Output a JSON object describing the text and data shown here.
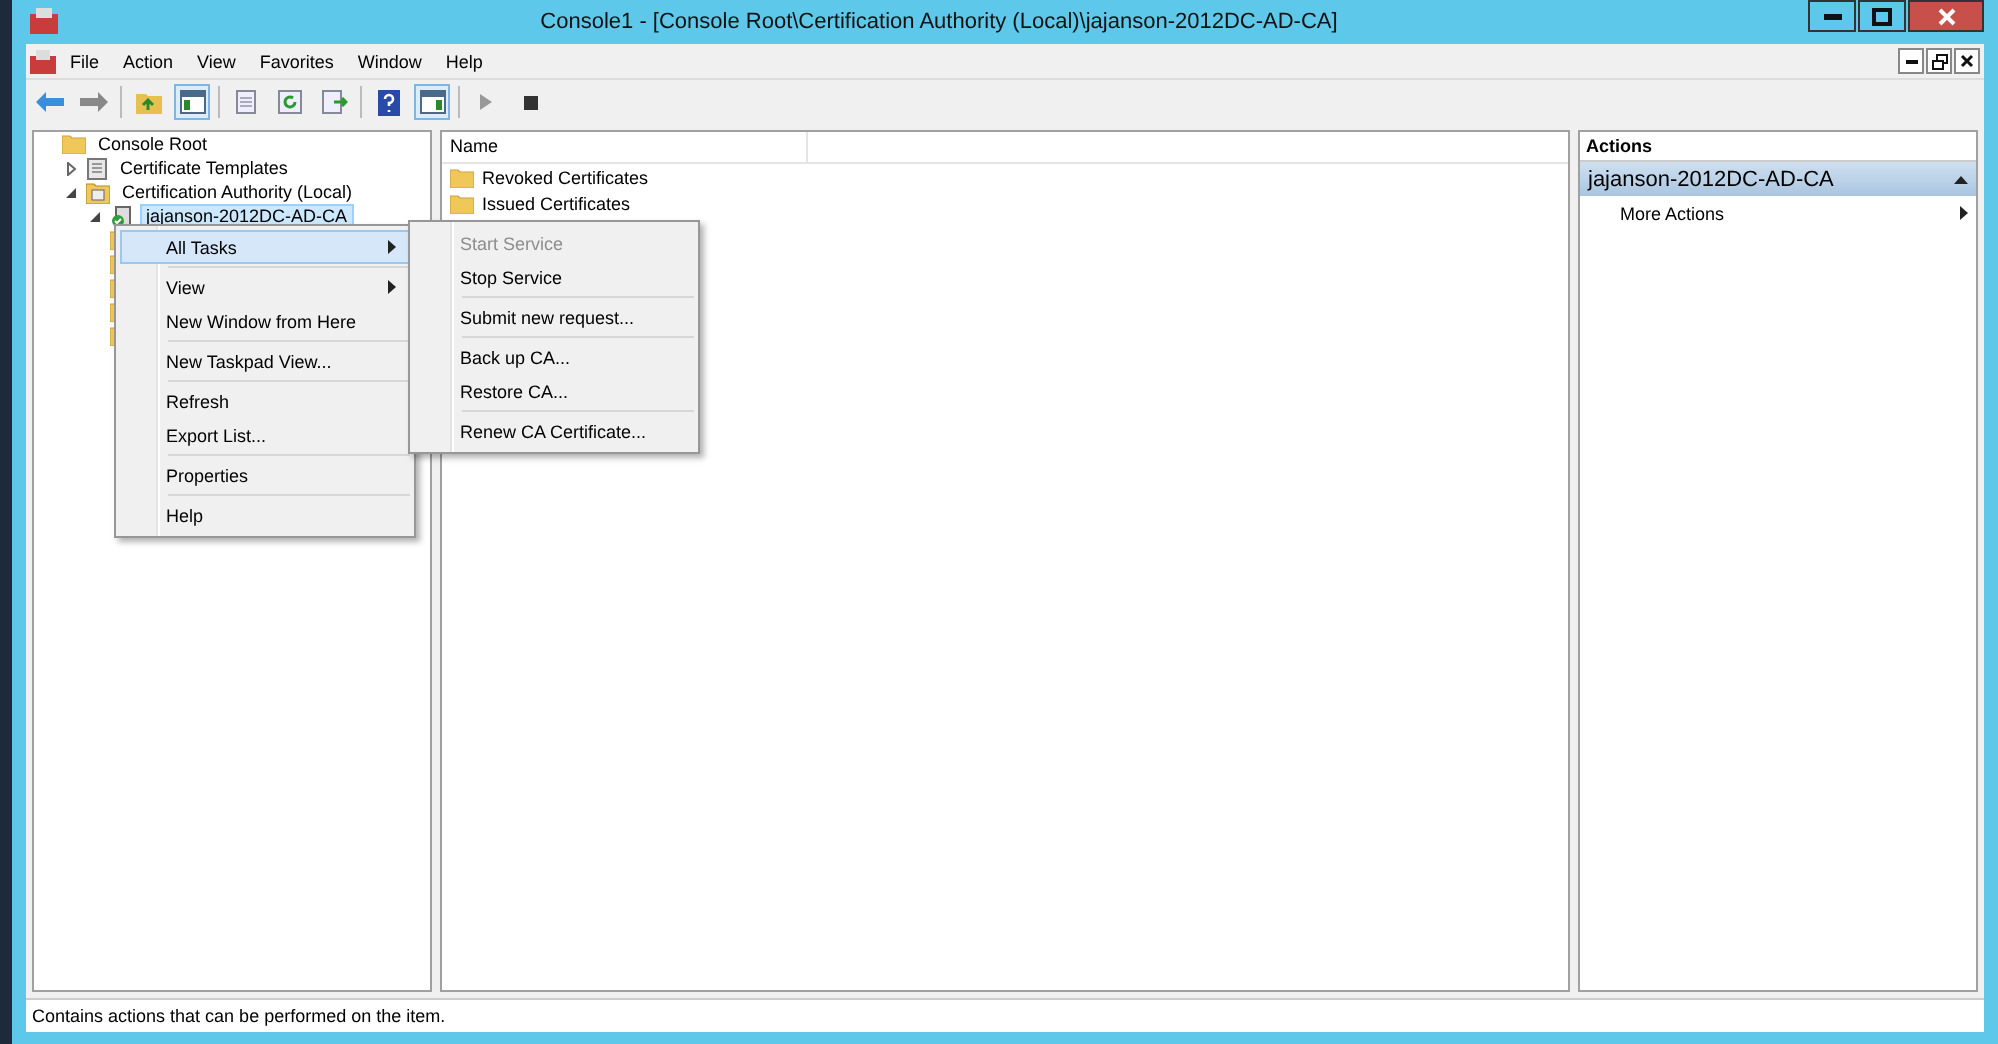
{
  "window": {
    "title": "Console1 - [Console Root\\Certification Authority (Local)\\jajanson-2012DC-AD-CA]"
  },
  "menu_bar": [
    "File",
    "Action",
    "View",
    "Favorites",
    "Window",
    "Help"
  ],
  "tree": [
    {
      "label": "Console Root",
      "children": [
        {
          "label": "Certificate Templates",
          "expanded": false
        },
        {
          "label": "Certification Authority (Local)",
          "expanded": true,
          "children": [
            {
              "label": "jajanson-2012DC-AD-CA",
              "expanded": true,
              "selected": true
            }
          ]
        }
      ]
    }
  ],
  "list": {
    "columns": [
      "Name"
    ],
    "rows": [
      "Revoked Certificates",
      "Issued Certificates"
    ]
  },
  "context_menu": [
    {
      "kind": "item",
      "label": "All Tasks",
      "submenu": true,
      "selected": true
    },
    {
      "kind": "separator"
    },
    {
      "kind": "item",
      "label": "View",
      "submenu": true,
      "selected": false
    },
    {
      "kind": "item",
      "label": "New Window from Here",
      "submenu": false,
      "selected": false
    },
    {
      "kind": "separator"
    },
    {
      "kind": "item",
      "label": "New Taskpad View...",
      "submenu": false,
      "selected": false
    },
    {
      "kind": "separator"
    },
    {
      "kind": "item",
      "label": "Refresh",
      "submenu": false,
      "selected": false
    },
    {
      "kind": "item",
      "label": "Export List...",
      "submenu": false,
      "selected": false
    },
    {
      "kind": "separator"
    },
    {
      "kind": "item",
      "label": "Properties",
      "submenu": false,
      "selected": false
    },
    {
      "kind": "separator"
    },
    {
      "kind": "item",
      "label": "Help",
      "submenu": false,
      "selected": false
    }
  ],
  "submenu": [
    {
      "kind": "item",
      "label": "Start Service",
      "disabled": true
    },
    {
      "kind": "item",
      "label": "Stop Service",
      "disabled": false
    },
    {
      "kind": "separator"
    },
    {
      "kind": "item",
      "label": "Submit new request...",
      "disabled": false
    },
    {
      "kind": "separator"
    },
    {
      "kind": "item",
      "label": "Back up CA...",
      "disabled": false
    },
    {
      "kind": "item",
      "label": "Restore CA...",
      "disabled": false
    },
    {
      "kind": "separator"
    },
    {
      "kind": "item",
      "label": "Renew CA Certificate...",
      "disabled": false
    }
  ],
  "actions": {
    "title": "Actions",
    "section": "jajanson-2012DC-AD-CA",
    "items": [
      {
        "label": "More Actions",
        "submenu": true
      }
    ]
  },
  "status_bar": "Contains actions that can be performed on the item."
}
